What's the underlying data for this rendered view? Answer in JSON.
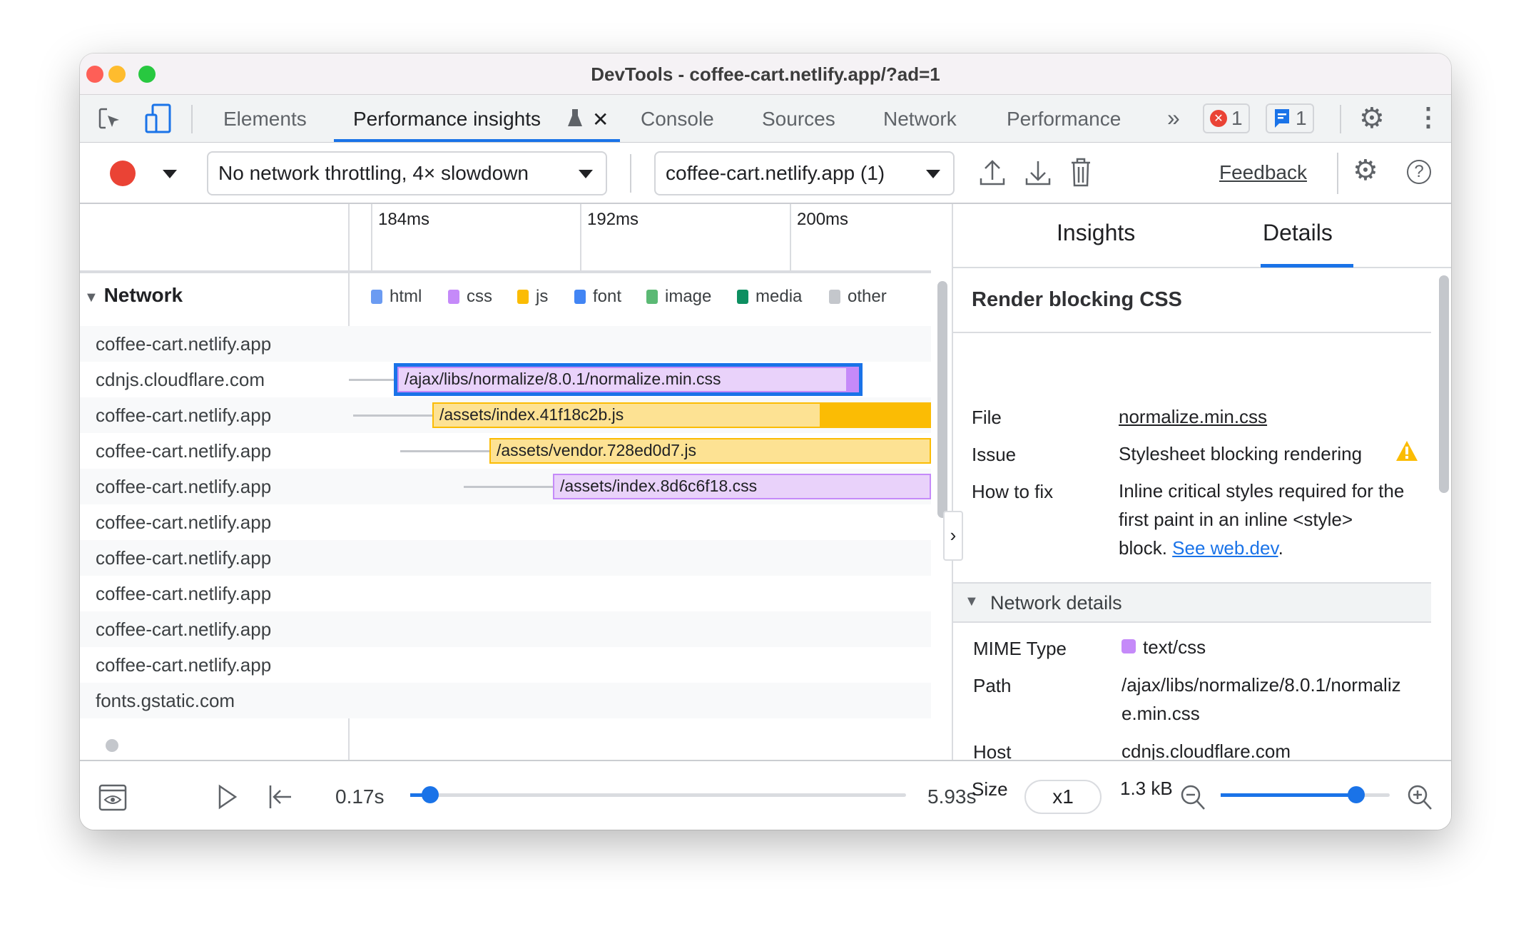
{
  "window": {
    "title": "DevTools - coffee-cart.netlify.app/?ad=1"
  },
  "tabs": {
    "items": [
      {
        "label": "Elements"
      },
      {
        "label": "Performance insights",
        "active": true
      },
      {
        "label": "Console"
      },
      {
        "label": "Sources"
      },
      {
        "label": "Network"
      },
      {
        "label": "Performance"
      }
    ],
    "more": "»",
    "errors": "1",
    "messages": "1"
  },
  "toolbar": {
    "throttling": "No network throttling, 4× slowdown",
    "page": "coffee-cart.netlify.app (1)",
    "feedback": "Feedback"
  },
  "timeline": {
    "ticks": [
      "184ms",
      "192ms",
      "200ms"
    ],
    "section": "Network",
    "legend": [
      {
        "label": "html",
        "color": "#6b9bf2"
      },
      {
        "label": "css",
        "color": "#c58af9"
      },
      {
        "label": "js",
        "color": "#fbbc04"
      },
      {
        "label": "font",
        "color": "#4285f4"
      },
      {
        "label": "image",
        "color": "#5bb974"
      },
      {
        "label": "media",
        "color": "#0d8f61"
      },
      {
        "label": "other",
        "color": "#c4c7cc"
      }
    ],
    "rows": [
      {
        "host": "coffee-cart.netlify.app"
      },
      {
        "host": "cdnjs.cloudflare.com",
        "request": "/ajax/libs/normalize/8.0.1/normalize.min.css",
        "type": "css",
        "selected": true
      },
      {
        "host": "coffee-cart.netlify.app",
        "request": "/assets/index.41f18c2b.js",
        "type": "js"
      },
      {
        "host": "coffee-cart.netlify.app",
        "request": "/assets/vendor.728ed0d7.js",
        "type": "js"
      },
      {
        "host": "coffee-cart.netlify.app",
        "request": "/assets/index.8d6c6f18.css",
        "type": "css"
      },
      {
        "host": "coffee-cart.netlify.app"
      },
      {
        "host": "coffee-cart.netlify.app"
      },
      {
        "host": "coffee-cart.netlify.app"
      },
      {
        "host": "coffee-cart.netlify.app"
      },
      {
        "host": "coffee-cart.netlify.app"
      },
      {
        "host": "fonts.gstatic.com"
      }
    ]
  },
  "sidebar": {
    "tabs": [
      "Insights",
      "Details"
    ],
    "active_tab": "Details",
    "heading": "Render blocking CSS",
    "file_label": "File",
    "file": "normalize.min.css",
    "issue_label": "Issue",
    "issue": "Stylesheet blocking rendering",
    "fix_label": "How to fix",
    "fix_l1": "Inline critical styles required for the",
    "fix_l2": "first paint in an inline <style>",
    "fix_l3": "block.",
    "fix_link": "See web.dev",
    "fix_end": ".",
    "network_details": "Network details",
    "mime_label": "MIME Type",
    "mime": "text/css",
    "path_label": "Path",
    "path_l1": "/ajax/libs/normalize/8.0.1/normaliz",
    "path_l2": "e.min.css",
    "host_label": "Host",
    "host": "cdnjs.cloudflare.com",
    "size_label": "Size",
    "size": "1.3 kB"
  },
  "playback": {
    "start": "0.17s",
    "end": "5.93s",
    "speed": "x1",
    "progress_percent": 4,
    "zoom_percent": 80
  }
}
